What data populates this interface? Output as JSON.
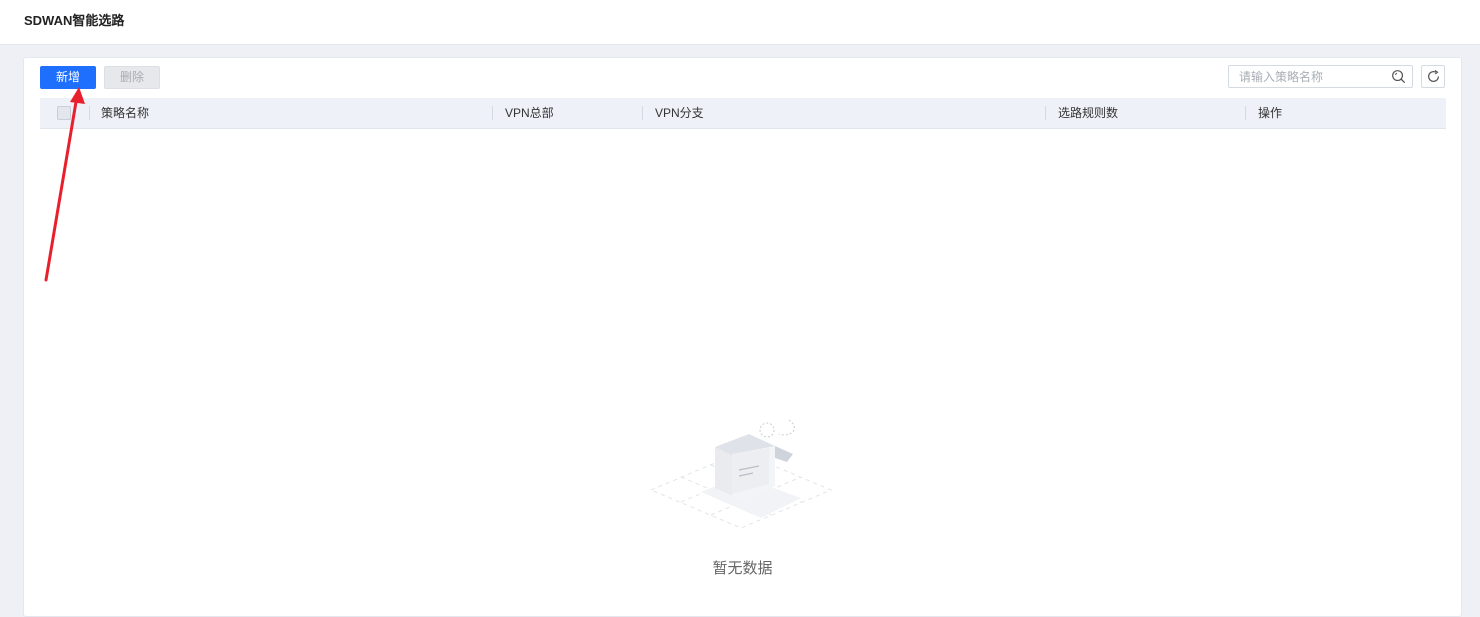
{
  "header": {
    "title": "SDWAN智能选路"
  },
  "toolbar": {
    "add_label": "新增",
    "delete_label": "删除",
    "search_placeholder": "请输入策略名称",
    "search_value": ""
  },
  "table": {
    "columns": [
      "策略名称",
      "VPN总部",
      "VPN分支",
      "选路规则数",
      "操作"
    ],
    "rows": []
  },
  "empty": {
    "text": "暂无数据"
  },
  "icons": {
    "search": "search-icon",
    "refresh": "refresh-icon",
    "empty": "empty-box-icon"
  },
  "colors": {
    "primary": "#1f6fff",
    "annotation": "#e8202e"
  }
}
